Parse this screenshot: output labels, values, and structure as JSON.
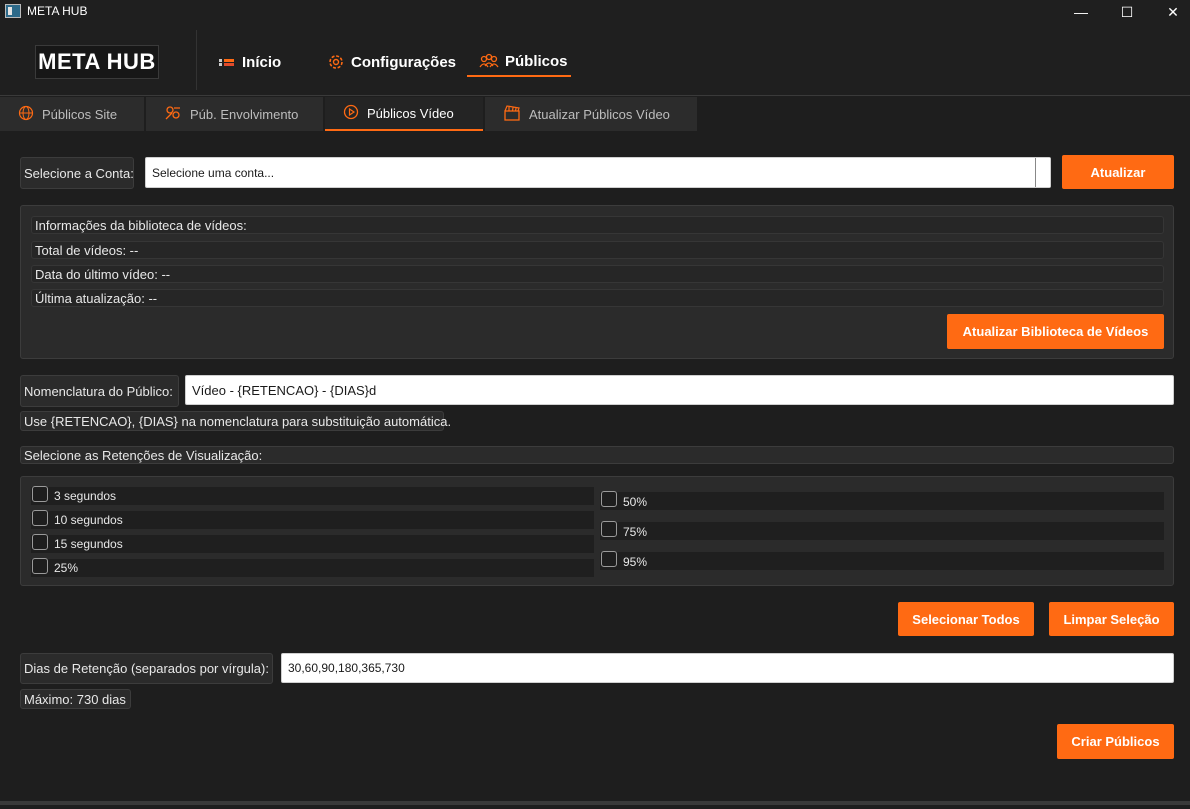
{
  "window": {
    "title": "META HUB",
    "controls": {
      "minimize": "—",
      "maximize": "☐",
      "close": "✕"
    }
  },
  "header": {
    "logo": "META HUB",
    "nav": [
      {
        "label": "Início",
        "icon": "home-icon"
      },
      {
        "label": "Configurações",
        "icon": "gear-icon"
      },
      {
        "label": "Públicos",
        "icon": "people-icon",
        "active": true
      }
    ]
  },
  "tabs": [
    {
      "label": "Públicos Site",
      "icon": "globe-icon"
    },
    {
      "label": "Púb. Envolvimento",
      "icon": "engagement-icon"
    },
    {
      "label": "Públicos Vídeo",
      "icon": "play-icon",
      "active": true
    },
    {
      "label": "Atualizar Públicos Vídeo",
      "icon": "clapperboard-icon"
    }
  ],
  "account": {
    "label": "Selecione a Conta:",
    "placeholder": "Selecione uma conta...",
    "button": "Atualizar"
  },
  "library": {
    "title": "Informações da biblioteca de vídeos:",
    "total": "Total de vídeos: --",
    "last_video": "Data do último vídeo: --",
    "last_update": "Última atualização: --",
    "button": "Atualizar Biblioteca de Vídeos"
  },
  "naming": {
    "label": "Nomenclatura do Público:",
    "value": "Vídeo - {RETENCAO} - {DIAS}d",
    "hint": "Use {RETENCAO}, {DIAS} na nomenclatura para substituição automática."
  },
  "retention": {
    "label": "Selecione as Retenções de Visualização:",
    "left": [
      {
        "label": "3 segundos",
        "checked": false
      },
      {
        "label": "10 segundos",
        "checked": false
      },
      {
        "label": "15 segundos",
        "checked": false
      },
      {
        "label": "25%",
        "checked": false
      }
    ],
    "right": [
      {
        "label": "50%",
        "checked": false
      },
      {
        "label": "75%",
        "checked": false
      },
      {
        "label": "95%",
        "checked": false
      }
    ],
    "select_all": "Selecionar Todos",
    "clear": "Limpar Seleção"
  },
  "days": {
    "label": "Dias de Retenção (separados por vírgula):",
    "value": "30,60,90,180,365,730",
    "max": "Máximo: 730 dias"
  },
  "create_button": "Criar Públicos",
  "colors": {
    "accent": "#ff6a13",
    "background": "#1e1e1e",
    "panel": "#2b2b2b"
  }
}
